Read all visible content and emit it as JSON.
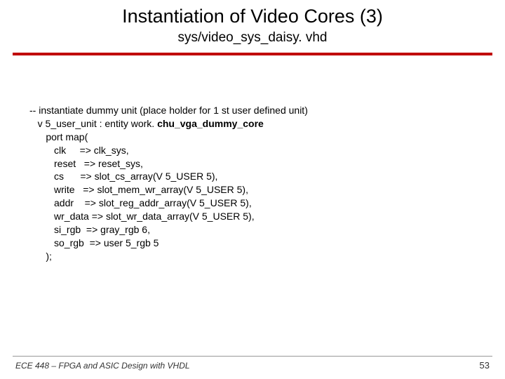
{
  "title": "Instantiation of Video Cores (3)",
  "subtitle": "sys/video_sys_daisy. vhd",
  "code": {
    "l1": "-- instantiate dummy unit (place holder for 1 st user defined unit)",
    "l2_a": "   v 5_user_unit : entity work. ",
    "l2_b": "chu_vga_dummy_core",
    "l3": "      port map(",
    "l4": "         clk     => clk_sys,",
    "l5": "         reset   => reset_sys,",
    "l6": "         cs      => slot_cs_array(V 5_USER 5),",
    "l7": "         write   => slot_mem_wr_array(V 5_USER 5),",
    "l8": "         addr    => slot_reg_addr_array(V 5_USER 5),",
    "l9": "         wr_data => slot_wr_data_array(V 5_USER 5),",
    "l10": "         si_rgb  => gray_rgb 6,",
    "l11": "         so_rgb  => user 5_rgb 5",
    "l12": "      );"
  },
  "footer": {
    "left": "ECE 448 – FPGA and ASIC Design with VHDL",
    "right": "53"
  }
}
